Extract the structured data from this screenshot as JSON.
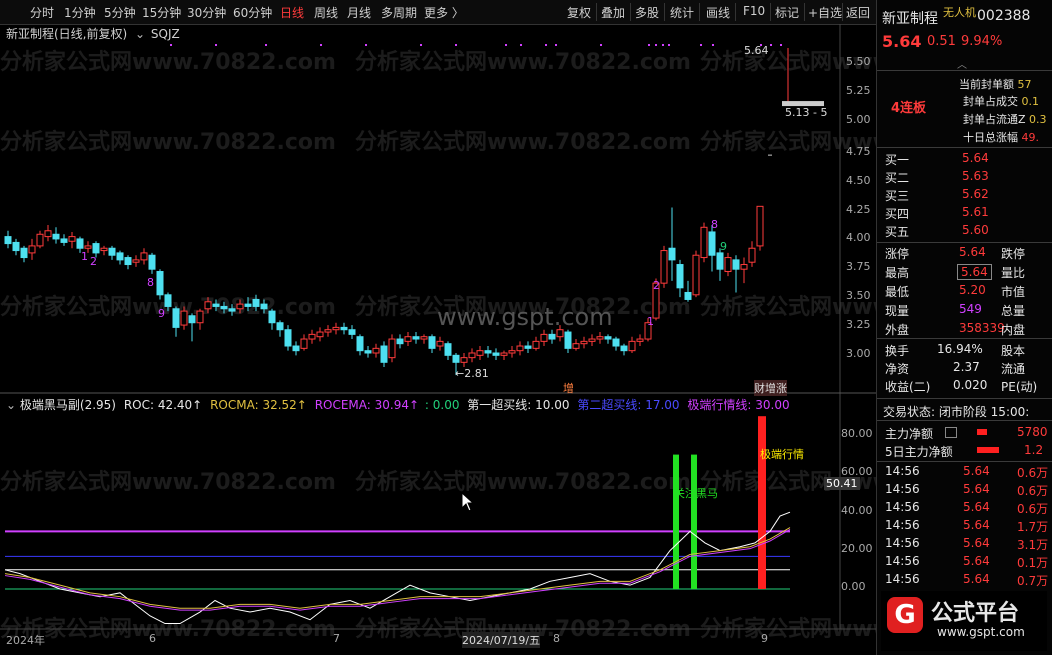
{
  "toolbar": {
    "left_items": [
      "分时",
      "1分钟",
      "5分钟",
      "15分钟",
      "30分钟",
      "60分钟",
      "日线",
      "周线",
      "月线",
      "多周期",
      "更多 〉"
    ],
    "active": "日线",
    "right_items": [
      "复权",
      "叠加",
      "多股",
      "统计",
      "画线",
      "F10",
      "标记",
      "+自选",
      "返回"
    ]
  },
  "main": {
    "title": "新亚制程(日线,前复权)",
    "indicator_name": "SQJZ",
    "price_axis": [
      "5.50",
      "5.25",
      "5.00",
      "4.75",
      "4.50",
      "4.25",
      "4.00",
      "3.75",
      "3.50",
      "3.25",
      "3.00"
    ],
    "high_label": "5.64",
    "low_label": "5.13 - 5",
    "min_label": "←2.81",
    "event_labels": [
      "增",
      "财",
      "增涨"
    ],
    "watermark_text": "分析家公式网www.70822.com",
    "center_watermark": "www.gspt.com",
    "td_numbers": [
      "1",
      "2",
      "8",
      "9",
      "2",
      "1",
      "8",
      "9"
    ]
  },
  "sub": {
    "title": "极端黑马副(2.95)",
    "roc_label": "ROC: 42.40↑",
    "rocma_label": "ROCMA: 32.52↑",
    "rocema_label": "ROCEMA: 30.94↑",
    "zero_label": ": 0.00",
    "line1_label": "第一超买线: 10.00",
    "line2_label": "第二超买线: 17.00",
    "line3_label": "极端行情线: 30.00",
    "axis": [
      "80.00",
      "60.00",
      "40.00",
      "20.00",
      "0.00"
    ],
    "current_value": "50.41",
    "annot_green": "关注黑马",
    "annot_red": "极端行情",
    "colors": {
      "roc": "#ffffff",
      "rocma": "#e0c040",
      "rocema": "#d040ff",
      "line3": "#d040ff",
      "line2": "#3a3aff",
      "line1": "#22d07a",
      "bar_green": "#22e022",
      "bar_red": "#ff2020"
    }
  },
  "xaxis": {
    "labels": [
      "2024年",
      "6",
      "7",
      "2024/07/19/五",
      "8",
      "9"
    ]
  },
  "panel": {
    "name": "新亚制程",
    "tag": "无人机",
    "code": "002388",
    "price": "5.64",
    "change": "0.51",
    "pct": "9.94%",
    "boards": "4连板",
    "seal_rows": [
      {
        "label": "当前封单额",
        "value": "57"
      },
      {
        "label": "封单占成交",
        "value": "0.1"
      },
      {
        "label": "封单占流通Z",
        "value": "0.3"
      },
      {
        "label": "十日总涨幅",
        "value": "49."
      }
    ],
    "bids": [
      {
        "label": "买一",
        "price": "5.64",
        "vol": ""
      },
      {
        "label": "买二",
        "price": "5.63",
        "vol": ""
      },
      {
        "label": "买三",
        "price": "5.62",
        "vol": ""
      },
      {
        "label": "买四",
        "price": "5.61",
        "vol": ""
      },
      {
        "label": "买五",
        "price": "5.60",
        "vol": ""
      }
    ],
    "stats": [
      {
        "l1": "涨停",
        "v1": "5.64",
        "l2": "跌停"
      },
      {
        "l1": "最高",
        "v1": "5.64",
        "l2": "量比"
      },
      {
        "l1": "最低",
        "v1": "5.20",
        "l2": "市值"
      },
      {
        "l1": "现量",
        "v1": "549",
        "l2": "总量"
      },
      {
        "l1": "外盘",
        "v1": "358339",
        "l2": "内盘"
      }
    ],
    "stats2": [
      {
        "l1": "换手",
        "v1": "16.94%",
        "l2": "股本"
      },
      {
        "l1": "净资",
        "v1": "2.37",
        "l2": "流通"
      },
      {
        "l1": "收益(二)",
        "v1": "0.020",
        "l2": "PE(动)"
      }
    ],
    "trade_state": "交易状态: 闭市阶段 15:00:",
    "main_net": {
      "label": "主力净额",
      "value": "5780"
    },
    "main_net5": {
      "label": "5日主力净额",
      "value": "1.2"
    },
    "ticks": [
      {
        "time": "14:56",
        "price": "5.64",
        "vol": "0.6万"
      },
      {
        "time": "14:56",
        "price": "5.64",
        "vol": "0.6万"
      },
      {
        "time": "14:56",
        "price": "5.64",
        "vol": "0.6万"
      },
      {
        "time": "14:56",
        "price": "5.64",
        "vol": "1.7万"
      },
      {
        "time": "14:56",
        "price": "5.64",
        "vol": "3.1万"
      },
      {
        "time": "14:56",
        "price": "5.64",
        "vol": "0.1万"
      },
      {
        "time": "14:56",
        "price": "5.64",
        "vol": "0.7万"
      }
    ],
    "logo_text": "公式平台",
    "logo_url": "www.gspt.com"
  }
}
